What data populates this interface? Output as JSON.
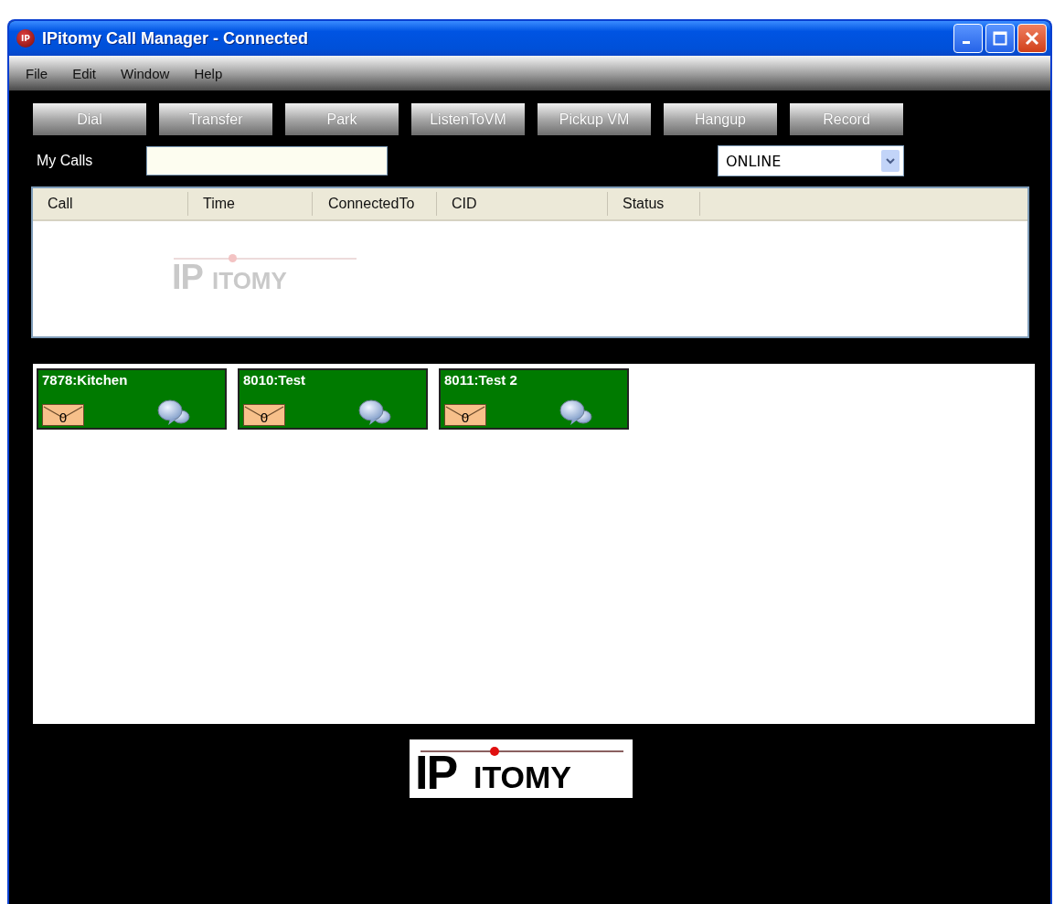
{
  "window": {
    "title": "IPitomy Call Manager - Connected",
    "app_icon": "IP"
  },
  "menu": [
    "File",
    "Edit",
    "Window",
    "Help"
  ],
  "toolbar": [
    "Dial",
    "Transfer",
    "Park",
    "ListenToVM",
    "Pickup VM",
    "Hangup",
    "Record"
  ],
  "my_calls": {
    "label": "My Calls"
  },
  "status_select": {
    "value": "ONLINE"
  },
  "table": {
    "columns": [
      "Call",
      "Time",
      "ConnectedTo",
      "CID",
      "Status"
    ],
    "watermark": {
      "big": "IP",
      "small": "ITOMY"
    }
  },
  "extensions": [
    {
      "name": "7878:Kitchen",
      "voicemail_count": "0",
      "color": "#007a00"
    },
    {
      "name": "8010:Test",
      "voicemail_count": "0",
      "color": "#007a00"
    },
    {
      "name": "8011:Test 2",
      "voicemail_count": "0",
      "color": "#007a00"
    }
  ],
  "footer_logo": {
    "big": "IP",
    "small": "ITOMY"
  }
}
